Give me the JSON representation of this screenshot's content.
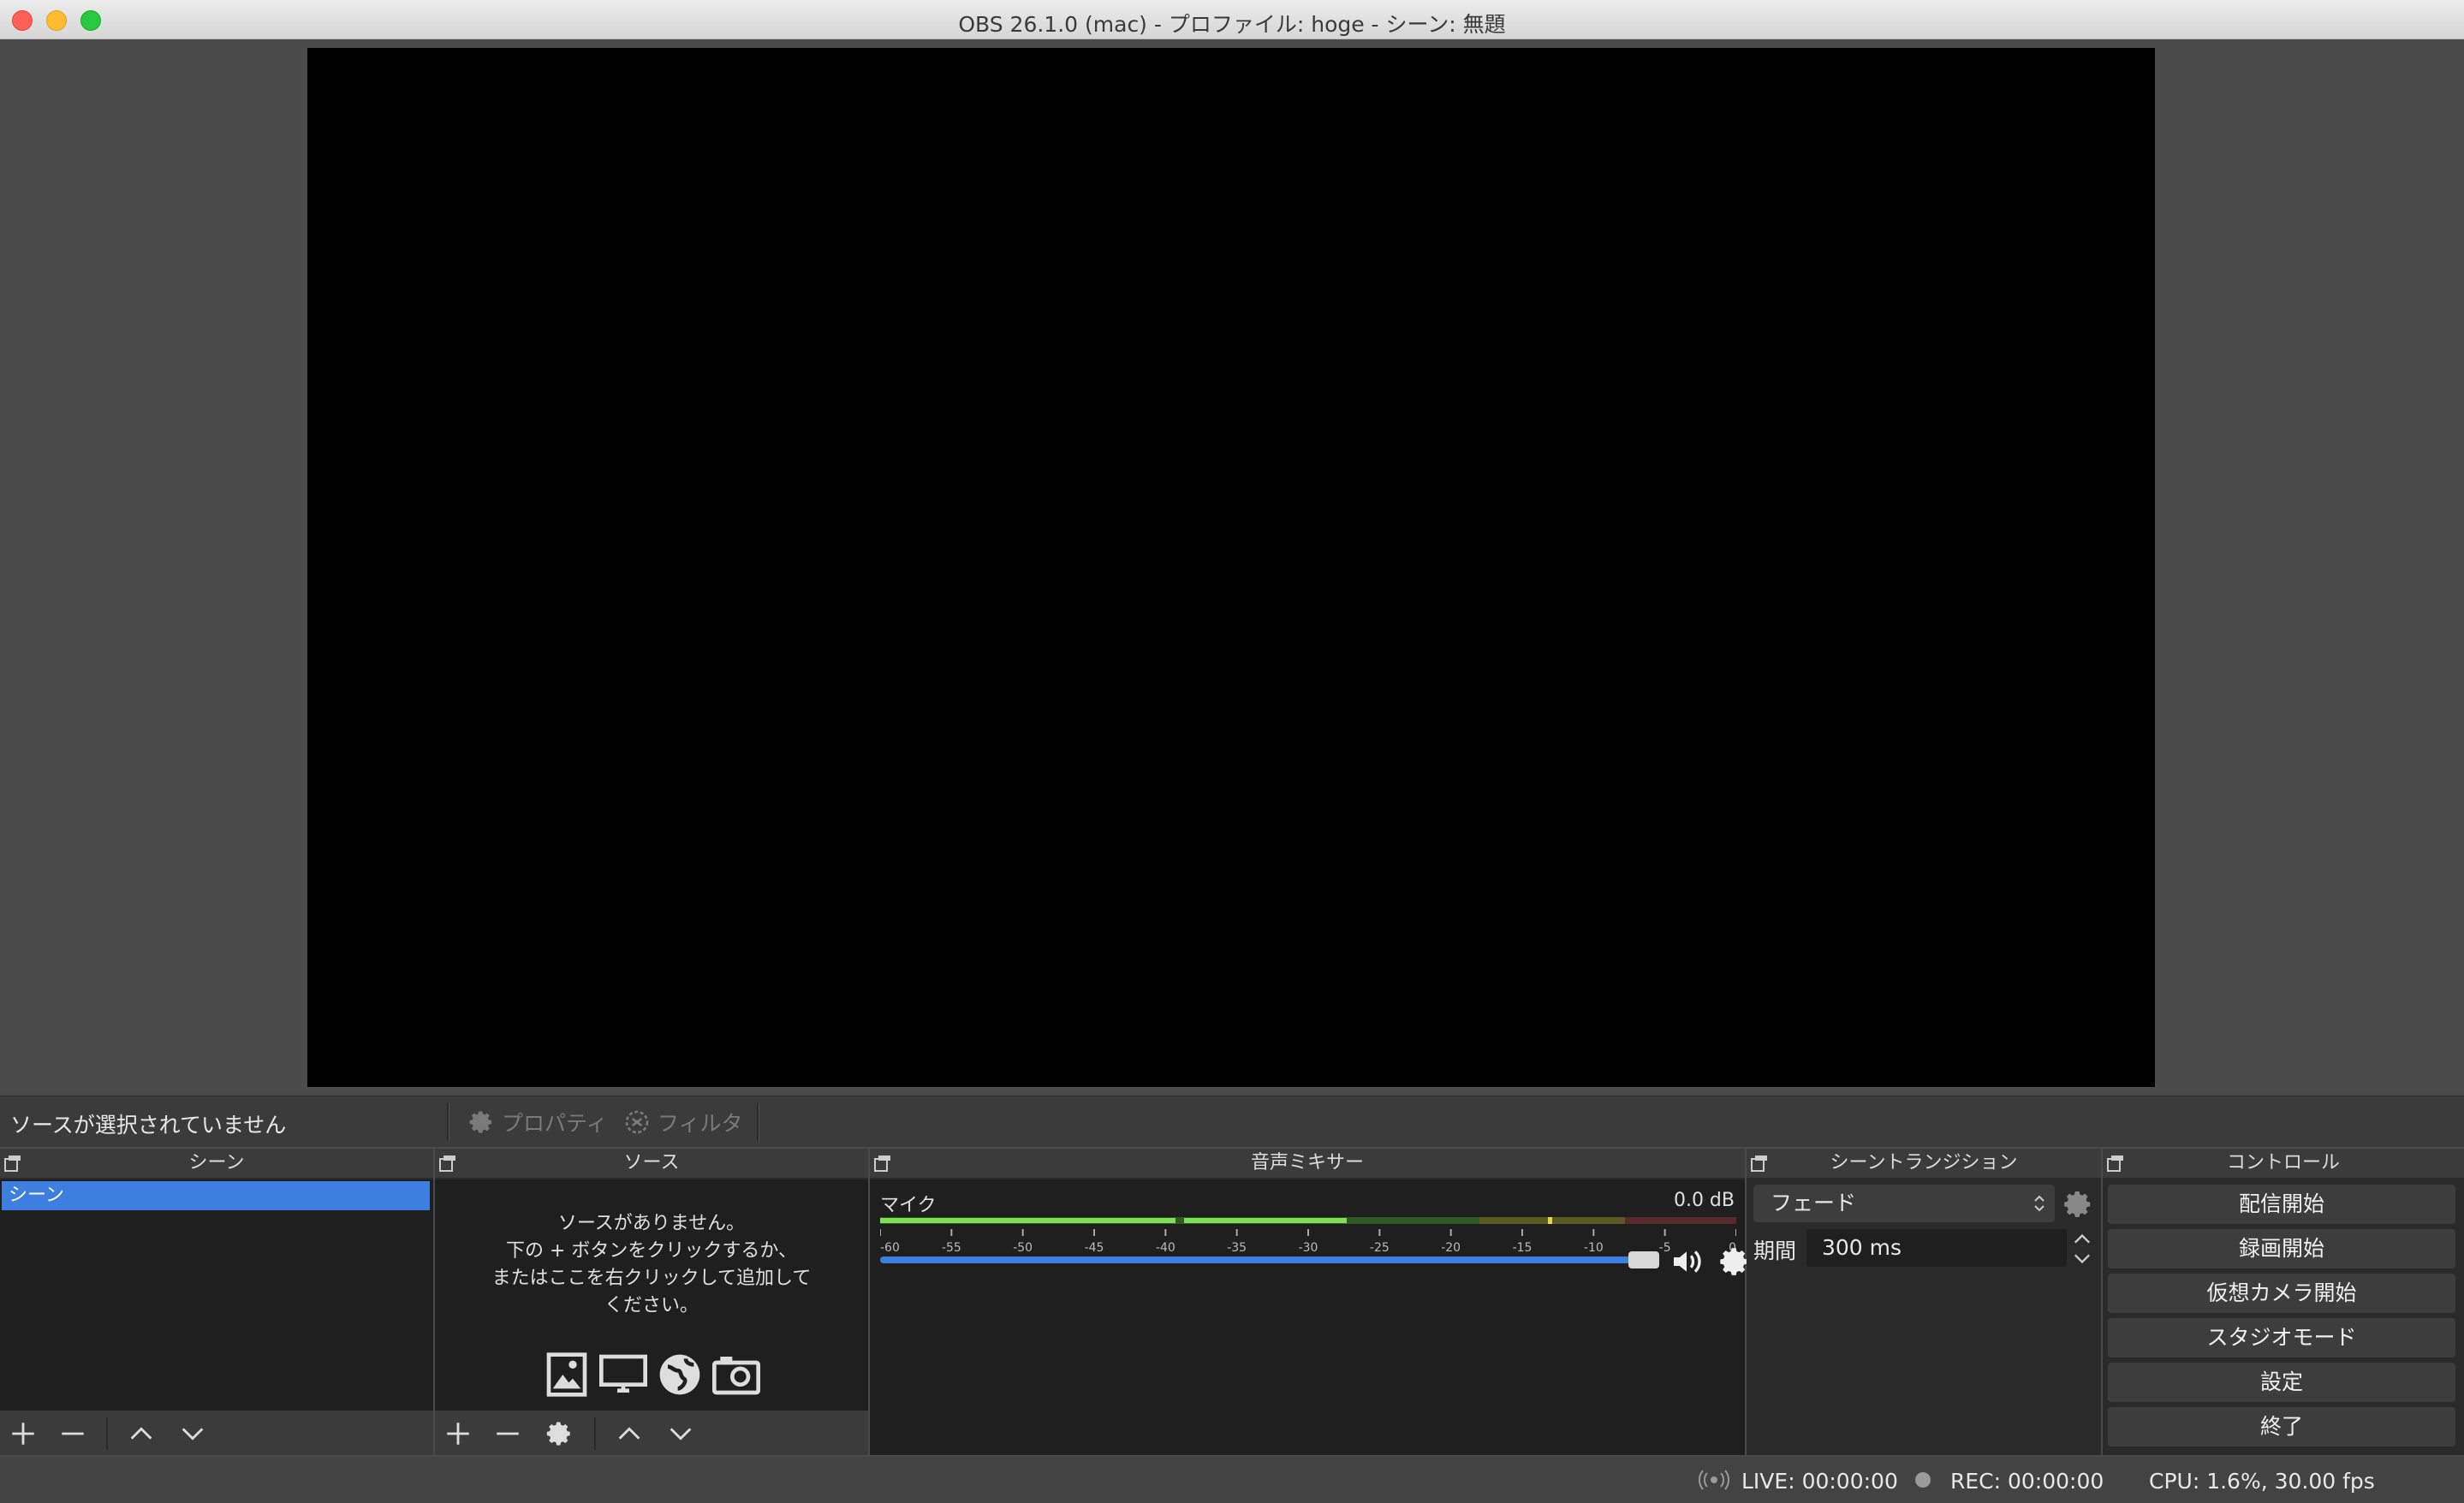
{
  "window": {
    "title": "OBS 26.1.0 (mac) - プロファイル: hoge - シーン: 無題"
  },
  "source_toolbar": {
    "status": "ソースが選択されていません",
    "properties_label": "プロパティ",
    "filters_label": "フィルタ"
  },
  "docks": {
    "scenes": {
      "title": "シーン",
      "items": [
        "シーン"
      ]
    },
    "sources": {
      "title": "ソース",
      "empty_lines": [
        "ソースがありません。",
        "下の + ボタンをクリックするか、",
        "またはここを右クリックして追加して",
        "ください。"
      ]
    },
    "mixer": {
      "title": "音声ミキサー",
      "channel_name": "マイク",
      "level": "0.0 dB",
      "volume_fraction": 0.97,
      "ticks": [
        "-60",
        "-55",
        "-50",
        "-45",
        "-40",
        "-35",
        "-30",
        "-25",
        "-20",
        "-15",
        "-10",
        "-5",
        "0"
      ]
    },
    "transitions": {
      "title": "シーントランジション",
      "selected": "フェード",
      "duration_label": "期間",
      "duration_value": "300 ms"
    },
    "controls": {
      "title": "コントロール",
      "buttons": [
        "配信開始",
        "録画開始",
        "仮想カメラ開始",
        "スタジオモード",
        "設定",
        "終了"
      ]
    }
  },
  "status": {
    "live": "LIVE: 00:00:00",
    "rec": "REC: 00:00:00",
    "perf": "CPU: 1.6%, 30.00 fps"
  },
  "colors": {
    "accent": "#3d7ede",
    "meter_green": "#7fe055",
    "meter_yellow": "#e0d84a",
    "meter_red": "#e05050"
  }
}
